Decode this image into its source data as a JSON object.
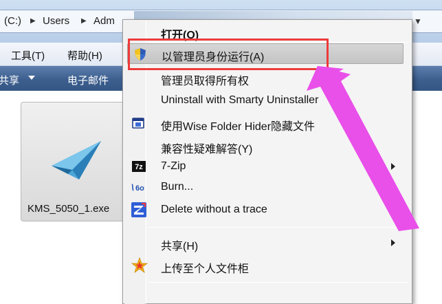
{
  "address_bar": {
    "crumbs": [
      "(C:)",
      "Users",
      "Adm"
    ]
  },
  "menu_bar": {
    "items": [
      "工具(T)",
      "帮助(H)"
    ]
  },
  "command_bar": {
    "share": "共享",
    "email": "电子邮件"
  },
  "file": {
    "name": "KMS_5050_1.exe"
  },
  "context_menu": {
    "items": [
      {
        "label": "打开(O)",
        "bold": true
      },
      {
        "label": "以管理员身份运行(A)"
      },
      {
        "label": "管理员取得所有权"
      },
      {
        "label": "Uninstall with Smarty Uninstaller"
      },
      {
        "label": "使用Wise Folder Hider隐藏文件"
      },
      {
        "label": "兼容性疑难解答(Y)"
      },
      {
        "label": "7-Zip"
      },
      {
        "label": "Burn..."
      },
      {
        "label": "Delete without a trace"
      },
      {
        "label": "共享(H)"
      },
      {
        "label": "上传至个人文件柜"
      }
    ]
  },
  "colors": {
    "highlight_box": "#ee3a3a",
    "annotation_arrow": "#e94fe9",
    "command_bar": "#3d5f8f"
  }
}
